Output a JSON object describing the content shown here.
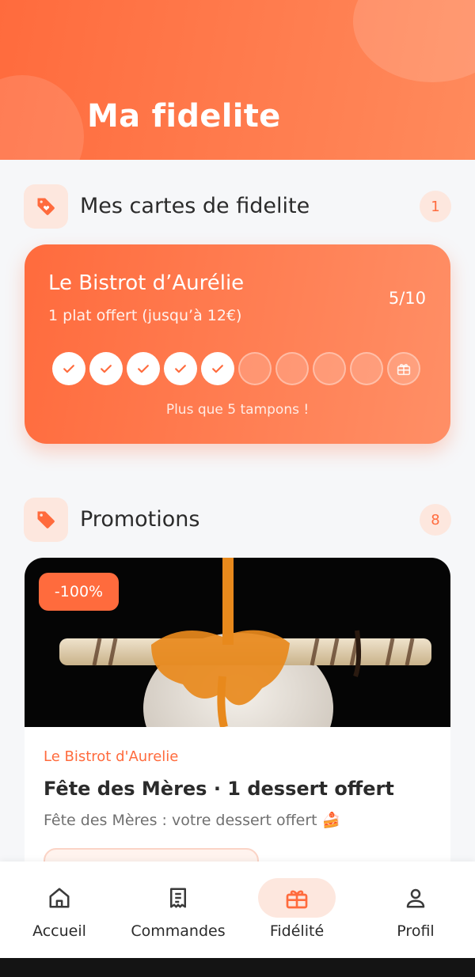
{
  "header": {
    "title": "Ma fidelite"
  },
  "loyalty_section": {
    "title": "Mes cartes de fidelite",
    "count": "1"
  },
  "loyalty_card": {
    "restaurant": "Le Bistrot d’Aurélie",
    "reward": "1 plat offert (jusqu’à 12€)",
    "progress_label": "5/10",
    "stamps_collected": 5,
    "stamps_total": 10,
    "remaining_text": "Plus que 5 tampons !"
  },
  "promotions_section": {
    "title": "Promotions",
    "count": "8"
  },
  "promotion": {
    "discount": "-100%",
    "restaurant": "Le Bistrot d'Aurelie",
    "title": "Fête des Mères · 1 dessert offert",
    "description": "Fête des Mères : votre dessert offert 🍰"
  },
  "nav": {
    "items": [
      {
        "label": "Accueil",
        "icon": "home-icon"
      },
      {
        "label": "Commandes",
        "icon": "receipt-icon"
      },
      {
        "label": "Fidélité",
        "icon": "gift-icon"
      },
      {
        "label": "Profil",
        "icon": "user-icon"
      }
    ],
    "active": "Fidélité"
  },
  "colors": {
    "accent": "#ff6b3d",
    "accent_soft": "#fde7de",
    "background": "#f6f7f9"
  }
}
